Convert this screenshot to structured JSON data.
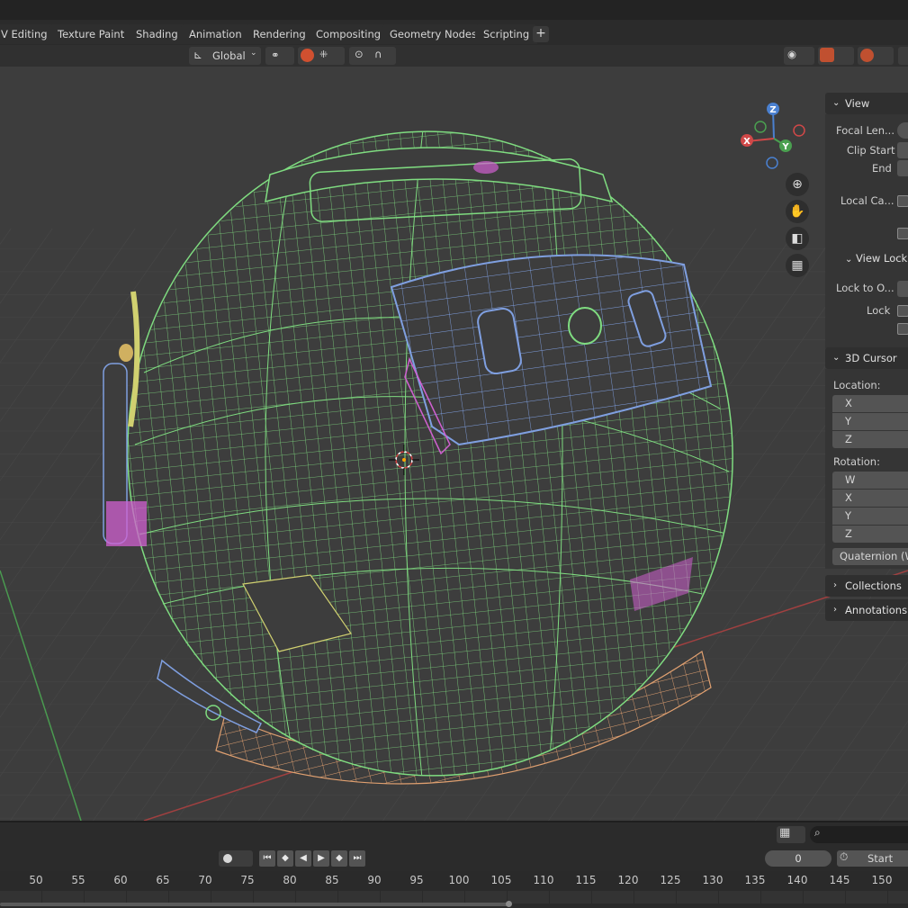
{
  "workspace_tabs": [
    "V Editing",
    "Texture Paint",
    "Shading",
    "Animation",
    "Rendering",
    "Compositing",
    "Geometry Nodes",
    "Scripting"
  ],
  "header": {
    "orientation": "Global"
  },
  "nav_gizmo": {
    "z": "Z",
    "x": "X",
    "y": "Y"
  },
  "npanel": {
    "view": {
      "title": "View",
      "focal_length": "Focal Len...",
      "clip_start": "Clip Start",
      "clip_end": "End",
      "local_camera": "Local Ca..."
    },
    "view_lock": {
      "title": "View Lock",
      "lock_to_object": "Lock to O...",
      "lock": "Lock"
    },
    "cursor": {
      "title": "3D Cursor",
      "location": "Location:",
      "rotation": "Rotation:",
      "x": "X",
      "y": "Y",
      "z": "Z",
      "w": "W",
      "rotation_mode": "Quaternion (WX"
    },
    "collections": "Collections",
    "annotations": "Annotations"
  },
  "timeline": {
    "current_frame": "0",
    "start_label": "Start",
    "ticks": [
      "50",
      "55",
      "60",
      "65",
      "70",
      "75",
      "80",
      "85",
      "90",
      "95",
      "100",
      "105",
      "110",
      "115",
      "120",
      "125",
      "130",
      "135",
      "140",
      "145",
      "150"
    ]
  },
  "colors": {
    "viewport": "#3d3d3d",
    "wire_main": "#7fdc80",
    "wire_visor": "#7f9fe0",
    "wire_ring": "#e0a070",
    "wire_pink": "#d060d0",
    "wire_yellow": "#d0d070",
    "axis_x": "#b04040",
    "axis_y": "#4aa050"
  }
}
